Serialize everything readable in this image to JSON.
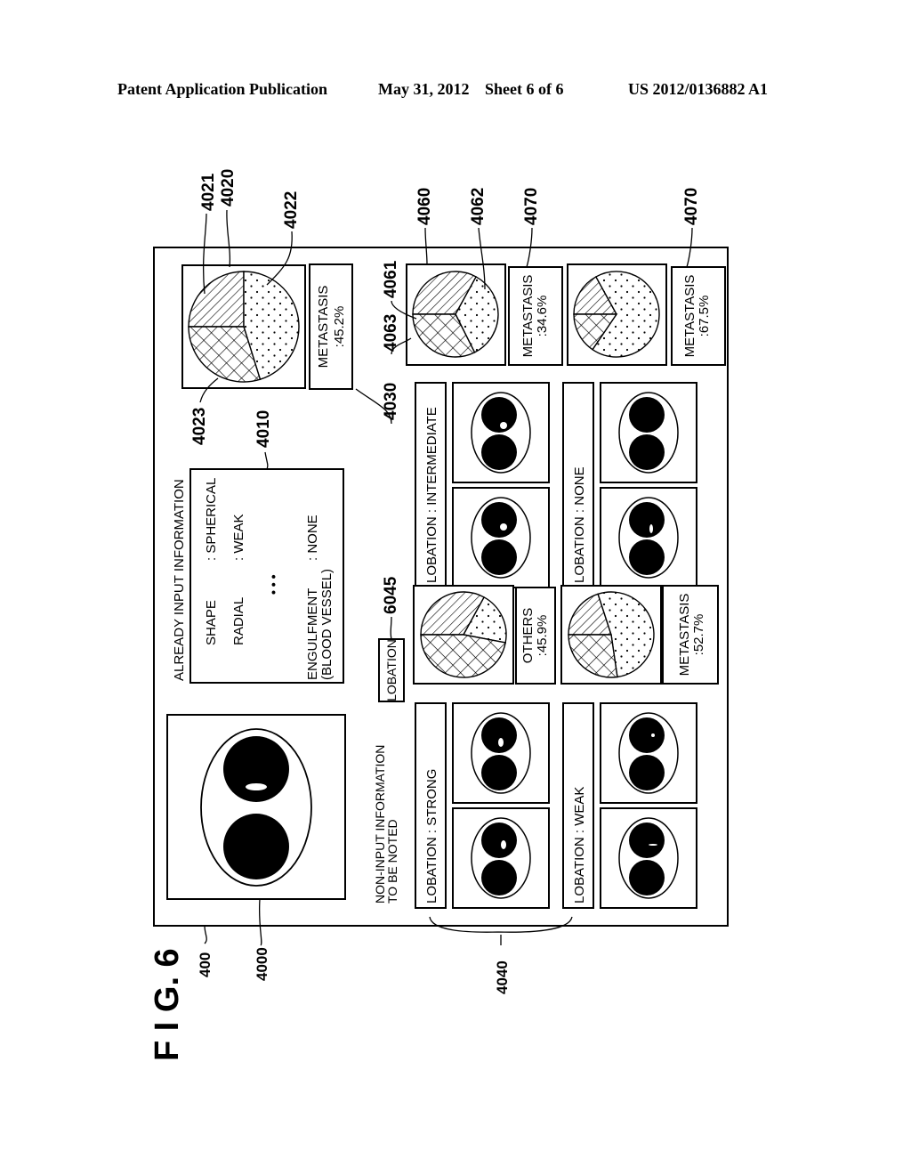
{
  "header": {
    "publication": "Patent Application Publication",
    "date": "May 31, 2012",
    "sheet": "Sheet 6 of 6",
    "number": "US 2012/0136882 A1"
  },
  "figure": {
    "label": "F I G.  6",
    "refs": {
      "screen": "400",
      "image": "4000",
      "input_info": "4010",
      "main_pie": "4020",
      "main_pie_slice_a": "4021",
      "main_pie_slice_b": "4022",
      "main_pie_slice_c": "4023",
      "main_result": "4030",
      "case_groups": "4040",
      "item_button": "6045",
      "pie_group": "4060",
      "pie_slice_a": "4061",
      "pie_slice_b": "4062",
      "pie_slice_c": "4063",
      "result_a": "4070",
      "result_b": "4070"
    },
    "input_info": {
      "title": "ALREADY INPUT INFORMATION",
      "rows": [
        {
          "key": "SHAPE",
          "value": ": SPHERICAL"
        },
        {
          "key": "RADIAL",
          "value": ": WEAK"
        },
        {
          "key": "ENGULFMENT",
          "key2": "(BLOOD VESSEL)",
          "value": ": NONE"
        }
      ],
      "ellipsis": "• • •"
    },
    "main_result": {
      "line1": "METASTASIS",
      "line2": ":45.2%"
    },
    "non_input": {
      "line1": "NON-INPUT INFORMATION",
      "line2": "TO BE NOTED"
    },
    "item_button": "LOBATION",
    "groups": [
      {
        "label": "LOBATION : STRONG",
        "result": {
          "line1": "OTHERS",
          "line2": ":45.9%"
        }
      },
      {
        "label": "LOBATION : WEAK",
        "result": {
          "line1": "METASTASIS",
          "line2": ":52.7%"
        }
      },
      {
        "label": "LOBATION : INTERMEDIATE",
        "result": {
          "line1": "METASTASIS",
          "line2": ":34.6%"
        }
      },
      {
        "label": "LOBATION : NONE",
        "result": {
          "line1": "METASTASIS",
          "line2": ":67.5%"
        }
      }
    ]
  },
  "chart_data": {
    "type": "pie",
    "legend": [
      "hatched (diagonal lines)",
      "dotted",
      "cross-hatched"
    ],
    "charts": [
      {
        "name": "already-input-pie",
        "slices": [
          0.25,
          0.452,
          0.298
        ],
        "highlight": "METASTASIS 45.2%"
      },
      {
        "name": "lobation-strong-pie",
        "slices": [
          0.33,
          0.2,
          0.47
        ],
        "highlight": "OTHERS 45.9%"
      },
      {
        "name": "lobation-weak-pie",
        "slices": [
          0.2,
          0.527,
          0.273
        ],
        "highlight": "METASTASIS 52.7%"
      },
      {
        "name": "lobation-intermediate-pie",
        "slices": [
          0.33,
          0.346,
          0.324
        ],
        "highlight": "METASTASIS 34.6%"
      },
      {
        "name": "lobation-none-pie",
        "slices": [
          0.17,
          0.675,
          0.155
        ],
        "highlight": "METASTASIS 67.5%"
      }
    ]
  }
}
